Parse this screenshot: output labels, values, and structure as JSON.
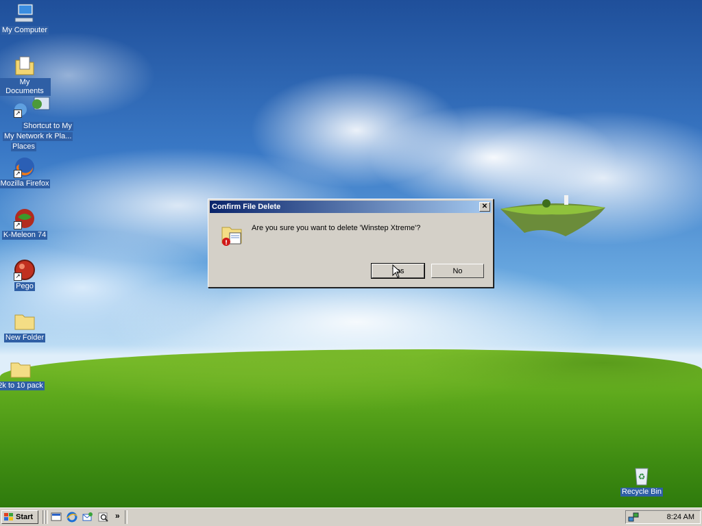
{
  "desktop": {
    "icons": [
      {
        "label": "My Computer",
        "icon": "my-computer-icon"
      },
      {
        "label": "My Documents",
        "icon": "my-documents-icon"
      },
      {
        "label": "Shortcut to My Network Places",
        "label_line1": "Shortcut to My",
        "label_line2": "My Network rk Pla...",
        "label_line3": "Places",
        "icon": "network-places-icon"
      },
      {
        "label": "Mozilla Firefox",
        "icon": "firefox-icon"
      },
      {
        "label": "K-Meleon 74",
        "icon": "k-meleon-icon"
      },
      {
        "label": "Pego",
        "icon": "pego-icon"
      },
      {
        "label": "New Folder",
        "icon": "folder-icon"
      },
      {
        "label": "2k to 10 pack",
        "icon": "folder-icon"
      },
      {
        "label": "Recycle Bin",
        "icon": "recycle-bin-icon"
      }
    ]
  },
  "dialog": {
    "title": "Confirm File Delete",
    "message": "Are you sure you want to delete 'Winstep Xtreme'?",
    "yes_label": "Yes",
    "no_label": "No",
    "close_label": "✕"
  },
  "taskbar": {
    "start_label": "Start",
    "chevron": "»",
    "clock": "8:24 AM",
    "quick_launch": [
      "show-desktop-icon",
      "internet-explorer-icon",
      "outlook-express-icon",
      "search-icon"
    ]
  },
  "colors": {
    "title_gradient_start": "#0a246a",
    "title_gradient_end": "#a6caf0",
    "dialog_face": "#d4d0c8",
    "icon_label_bg": "#2f5fa5"
  }
}
